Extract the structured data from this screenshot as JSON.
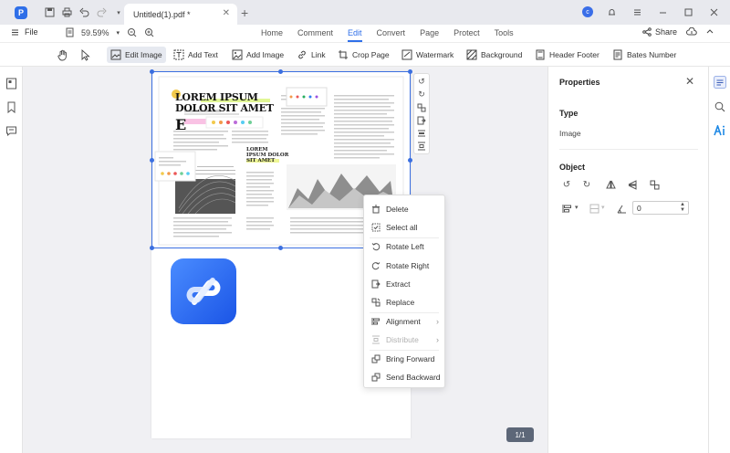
{
  "titlebar": {
    "tab_label": "Untitled(1).pdf *",
    "avatar_letter": "c"
  },
  "menubar": {
    "file_label": "File",
    "zoom_value": "59.59%",
    "tabs": [
      "Home",
      "Comment",
      "Edit",
      "Convert",
      "Page",
      "Protect",
      "Tools"
    ],
    "active_tab": "Edit",
    "share_label": "Share"
  },
  "toolbar": {
    "tools": [
      "Edit Image",
      "Add Text",
      "Add Image",
      "Link",
      "Crop Page",
      "Watermark",
      "Background",
      "Header Footer",
      "Bates Number"
    ],
    "active_tool": "Edit Image"
  },
  "document": {
    "headline_line1": "LOREM IPSUM",
    "headline_line2": "DOLOR SIT AMET",
    "drop_cap": "E",
    "subhead_line1": "LOREM",
    "subhead_line2": "IPSUM DOLOR",
    "subhead_line3": "SIT AMET",
    "page_indicator": "1/1"
  },
  "context_menu": {
    "items": [
      {
        "label": "Delete",
        "enabled": true
      },
      {
        "label": "Select all",
        "enabled": true
      },
      {
        "label": "Rotate Left",
        "enabled": true
      },
      {
        "label": "Rotate Right",
        "enabled": true
      },
      {
        "label": "Extract",
        "enabled": true
      },
      {
        "label": "Replace",
        "enabled": true
      },
      {
        "label": "Alignment",
        "enabled": true
      },
      {
        "label": "Distribute",
        "enabled": false
      },
      {
        "label": "Bring Forward",
        "enabled": true
      },
      {
        "label": "Send Backward",
        "enabled": true
      }
    ]
  },
  "properties": {
    "title": "Properties",
    "type_heading": "Type",
    "type_value": "Image",
    "object_heading": "Object",
    "rotation_value": "0"
  },
  "colors": {
    "accent": "#2f6fe8",
    "selection": "#3b6fe0",
    "page_indicator_bg": "#5d6778"
  }
}
